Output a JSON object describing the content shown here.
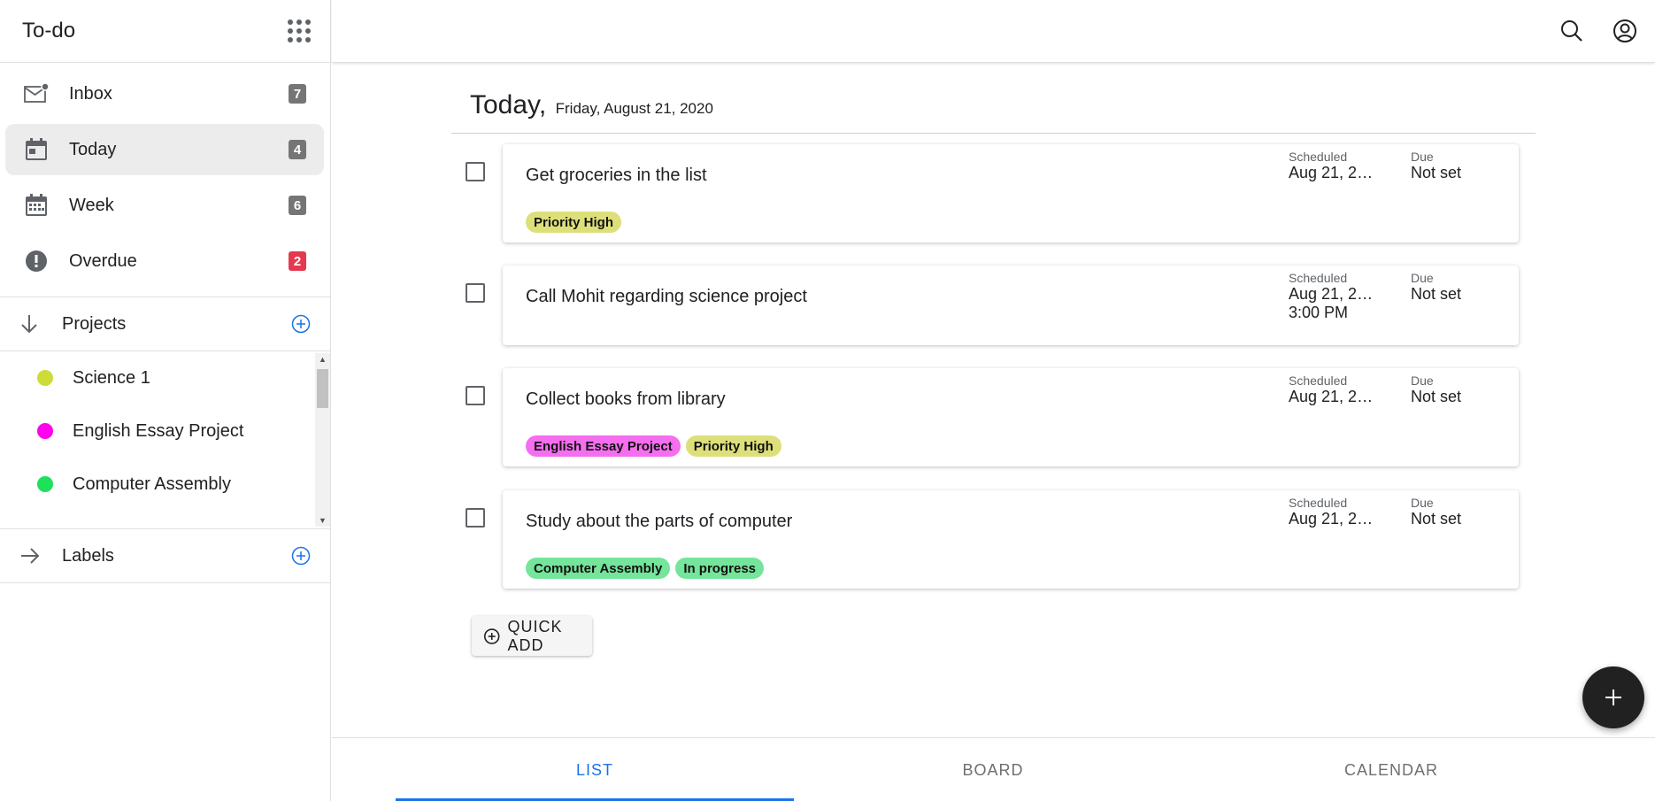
{
  "app": {
    "title": "To-do"
  },
  "nav": [
    {
      "label": "Inbox",
      "count": "7",
      "icon": "inbox-icon"
    },
    {
      "label": "Today",
      "count": "4",
      "icon": "calendar-today-icon"
    },
    {
      "label": "Week",
      "count": "6",
      "icon": "calendar-week-icon"
    },
    {
      "label": "Overdue",
      "count": "2",
      "icon": "alert-icon"
    }
  ],
  "projects": {
    "title": "Projects",
    "items": [
      {
        "label": "Science 1",
        "color": "#cddc39"
      },
      {
        "label": "English Essay Project",
        "color": "#ff00ee"
      },
      {
        "label": "Computer Assembly",
        "color": "#1ee05b"
      }
    ]
  },
  "labels": {
    "title": "Labels"
  },
  "day": {
    "title": "Today,",
    "date": "Friday, August 21, 2020"
  },
  "meta_labels": {
    "scheduled": "Scheduled",
    "due": "Due"
  },
  "tasks": [
    {
      "title": "Get groceries in the list",
      "scheduled": "Aug 21, 2…",
      "scheduled_time": "",
      "due": "Not set",
      "tags": [
        {
          "label": "Priority High",
          "color": "#dde07a"
        }
      ]
    },
    {
      "title": "Call Mohit regarding science project",
      "scheduled": "Aug 21, 2…",
      "scheduled_time": "3:00 PM",
      "due": "Not set",
      "tags": []
    },
    {
      "title": "Collect books from library",
      "scheduled": "Aug 21, 2…",
      "scheduled_time": "",
      "due": "Not set",
      "tags": [
        {
          "label": "English Essay Project",
          "color": "#f56ef0"
        },
        {
          "label": "Priority High",
          "color": "#dde07a"
        }
      ]
    },
    {
      "title": "Study about the parts of computer",
      "scheduled": "Aug 21, 2…",
      "scheduled_time": "",
      "due": "Not set",
      "tags": [
        {
          "label": "Computer Assembly",
          "color": "#74e59a"
        },
        {
          "label": "In progress",
          "color": "#74e59a"
        }
      ]
    }
  ],
  "quick_add": {
    "label": "QUICK ADD"
  },
  "tabs": [
    {
      "label": "LIST",
      "active": true
    },
    {
      "label": "BOARD",
      "active": false
    },
    {
      "label": "CALENDAR",
      "active": false
    }
  ],
  "colors": {
    "accent": "#1a73e8",
    "overdue": "#e53950",
    "fab": "#212121"
  }
}
